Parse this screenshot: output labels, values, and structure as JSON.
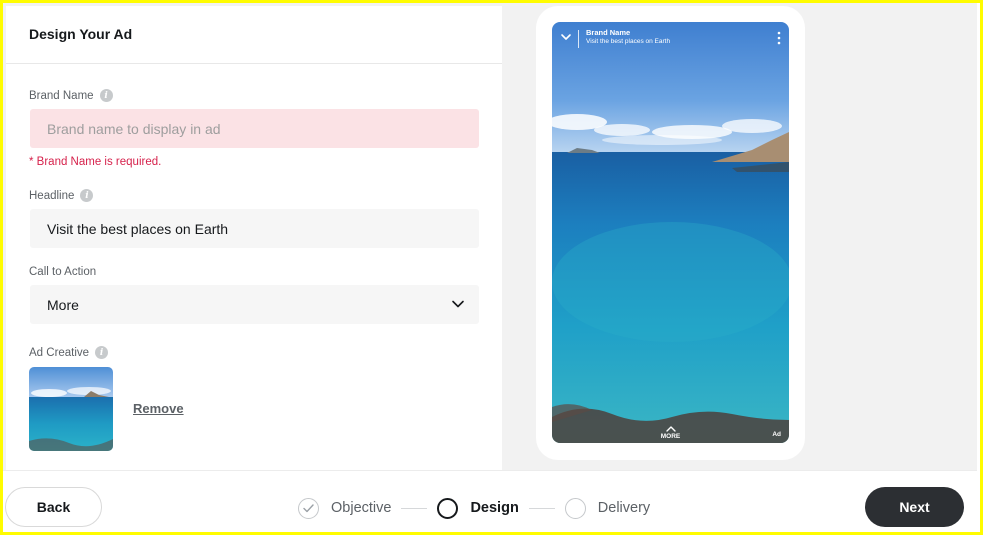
{
  "form": {
    "title": "Design Your Ad",
    "brand_name": {
      "label": "Brand Name",
      "placeholder": "Brand name to display in ad",
      "error": "* Brand Name is required."
    },
    "headline": {
      "label": "Headline",
      "value": "Visit the best places on Earth"
    },
    "call_to_action": {
      "label": "Call to Action",
      "selected": "More"
    },
    "ad_creative": {
      "label": "Ad Creative",
      "remove_label": "Remove"
    }
  },
  "preview": {
    "brand_name": "Brand Name",
    "headline": "Visit the best places on Earth",
    "more_label": "MORE",
    "ad_label": "Ad"
  },
  "footer": {
    "back_label": "Back",
    "next_label": "Next",
    "steps": [
      {
        "label": "Objective",
        "state": "completed"
      },
      {
        "label": "Design",
        "state": "active"
      },
      {
        "label": "Delivery",
        "state": "pending"
      }
    ]
  },
  "colors": {
    "accent_frame": "#fffc00",
    "error_text": "#d6224c",
    "error_bg": "#fbe2e5",
    "next_button": "#2c2f33"
  }
}
